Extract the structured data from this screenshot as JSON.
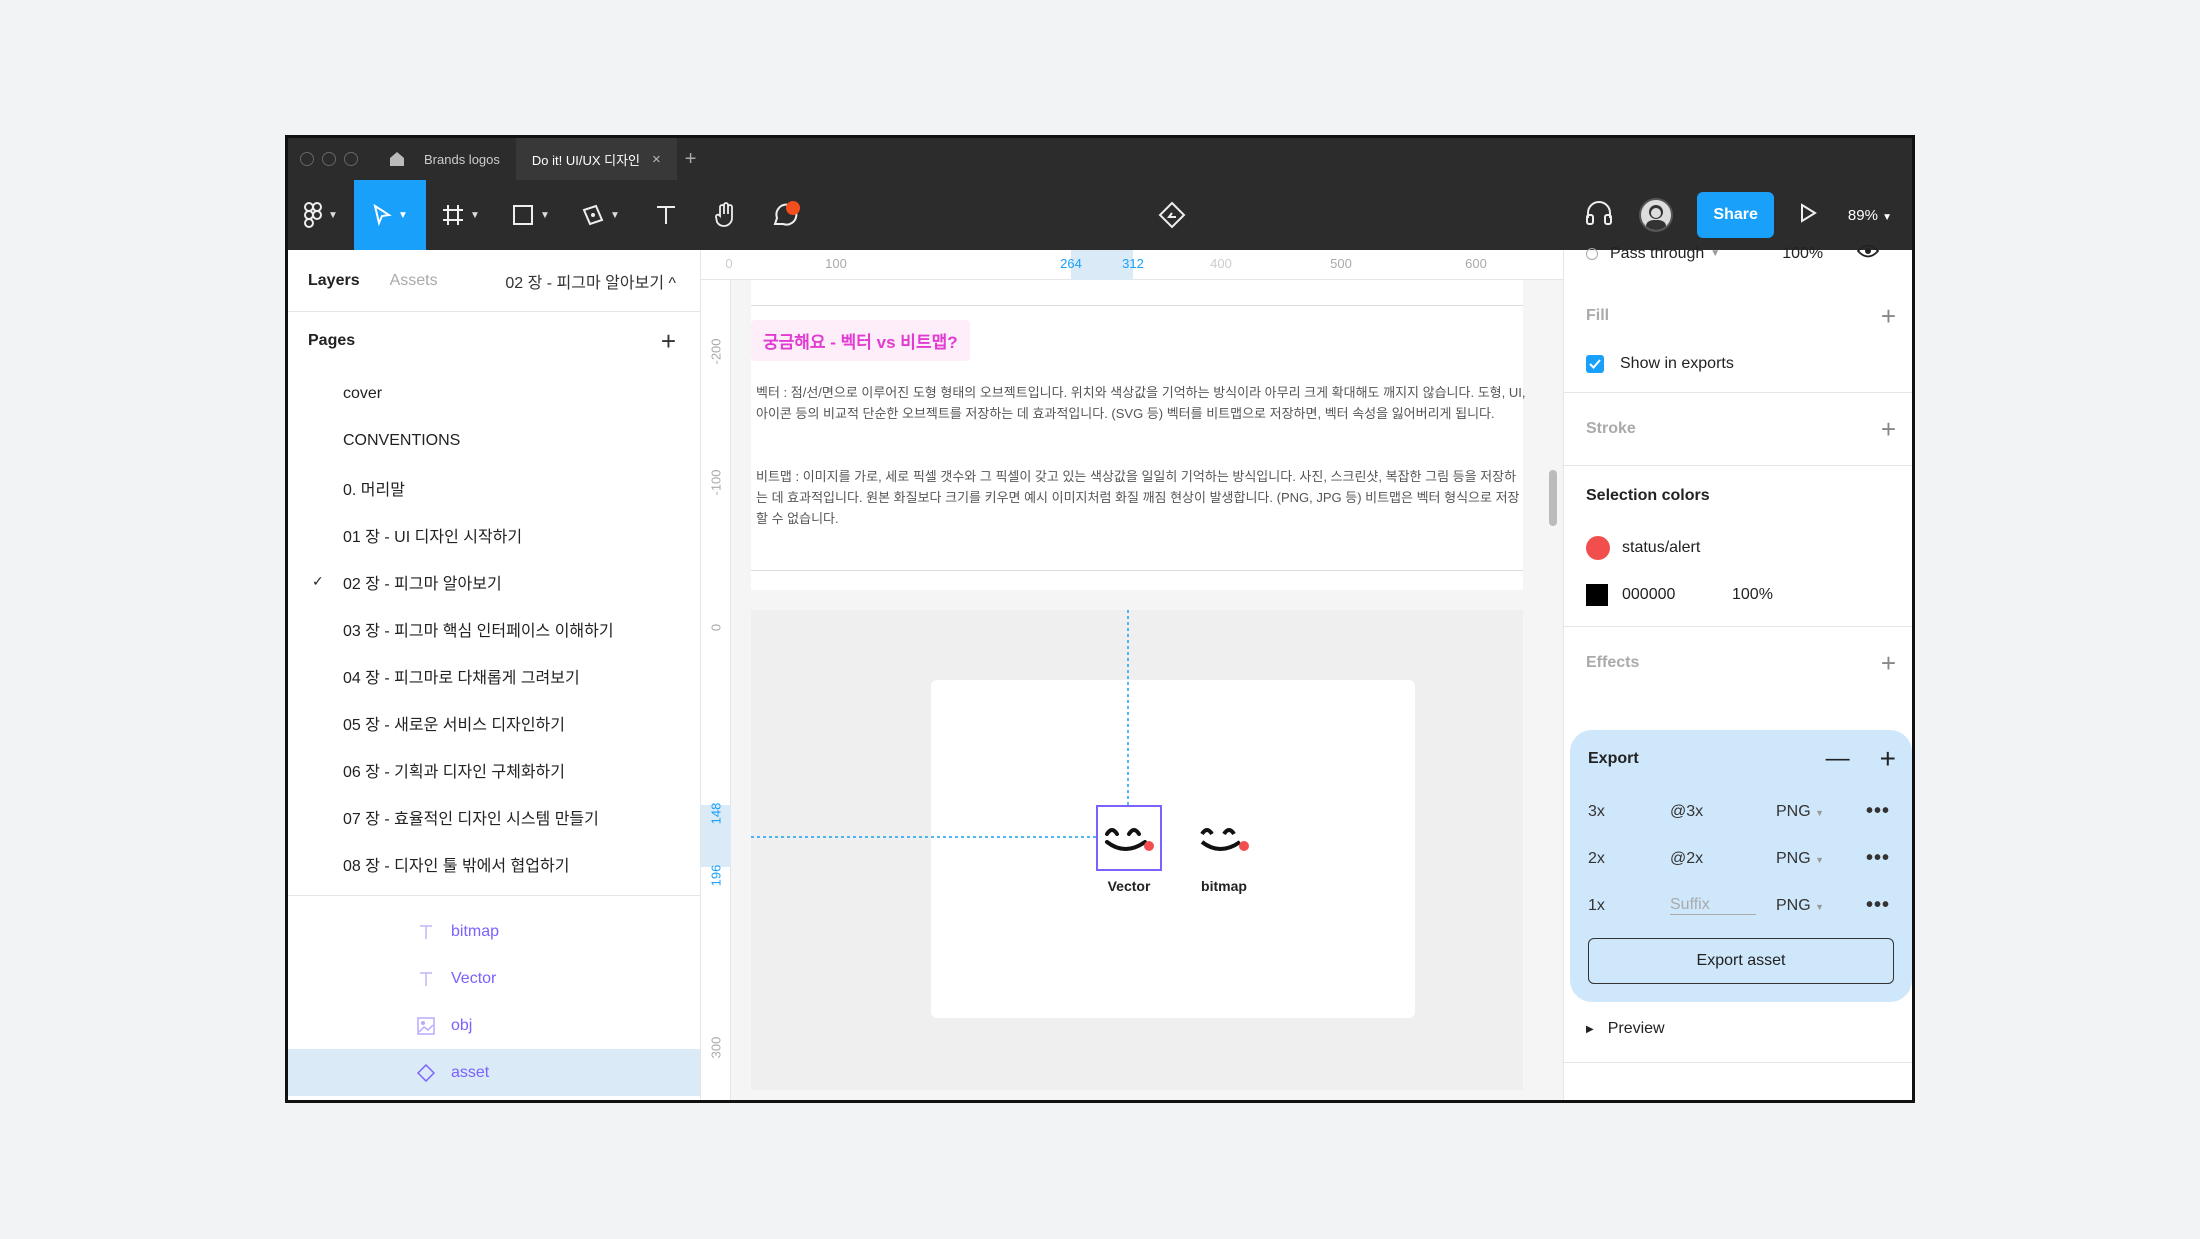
{
  "tabs": [
    {
      "label": "Brands logos"
    },
    {
      "label": "Do it! UI/UX 디자인"
    }
  ],
  "toolbar": {
    "share_label": "Share",
    "zoom": "89%"
  },
  "left": {
    "tab_layers": "Layers",
    "tab_assets": "Assets",
    "page_selector": "02 장 - 피그마 알아보기 ^",
    "pages_title": "Pages",
    "pages": [
      "cover",
      "CONVENTIONS",
      "0. 머리말",
      "01 장 - UI 디자인 시작하기",
      "02 장 - 피그마 알아보기",
      "03 장 - 피그마 핵심 인터페이스 이해하기",
      "04 장 - 피그마로 다채롭게 그려보기",
      "05 장 - 새로운 서비스 디자인하기",
      "06 장 - 기획과 디자인 구체화하기",
      "07 장 - 효율적인 디자인 시스템 만들기",
      "08 장 - 디자인 툴 밖에서 협업하기"
    ],
    "selected_page_check": "✓",
    "layers": [
      "bitmap",
      "Vector",
      "obj",
      "asset"
    ]
  },
  "ruler_top": [
    "0",
    "100",
    "264",
    "312",
    "400",
    "500",
    "600"
  ],
  "ruler_left": [
    "-200",
    "-100",
    "0",
    "148",
    "196",
    "300"
  ],
  "canvas": {
    "question_title": "궁금해요 - 벡터 vs 비트맵?",
    "para_vector": "벡터 : 점/선/면으로 이루어진 도형 형태의 오브젝트입니다. 위치와 색상값을 기억하는 방식이라 아무리 크게 확대해도 깨지지 않습니다. 도형, UI, 아이콘 등의 비교적 단순한 오브젝트를 저장하는 데 효과적입니다. (SVG 등) 벡터를 비트맵으로 저장하면, 벡터 속성을 잃어버리게 됩니다.",
    "para_bitmap": "비트맵 : 이미지를 가로, 세로 픽셀 갯수와 그 픽셀이 갖고 있는 색상값을 일일히 기억하는 방식입니다. 사진, 스크린샷, 복잡한 그림 등을 저장하는 데 효과적입니다. 원본 화질보다 크기를 키우면 예시 이미지처럼 화질 깨짐 현상이 발생합니다. (PNG, JPG 등) 비트맵은 벡터 형식으로 저장할 수 없습니다.",
    "label_vector": "Vector",
    "label_bitmap": "bitmap"
  },
  "right": {
    "blend_mode": "Pass through",
    "opacity": "100%",
    "fill_title": "Fill",
    "show_in_exports": "Show in exports",
    "stroke_title": "Stroke",
    "selection_colors_title": "Selection colors",
    "color1_name": "status/alert",
    "color2_name": "000000",
    "color2_opacity": "100%",
    "effects_title": "Effects",
    "export_title": "Export",
    "export_rows": [
      {
        "scale": "3x",
        "suffix": "@3x",
        "format": "PNG"
      },
      {
        "scale": "2x",
        "suffix": "@2x",
        "format": "PNG"
      },
      {
        "scale": "1x",
        "suffix": "Suffix",
        "format": "PNG"
      }
    ],
    "export_button": "Export asset",
    "preview": "Preview"
  },
  "colors": {
    "accent": "#18a0fb",
    "alert": "#f24e4e",
    "purple": "#7b61ff"
  }
}
